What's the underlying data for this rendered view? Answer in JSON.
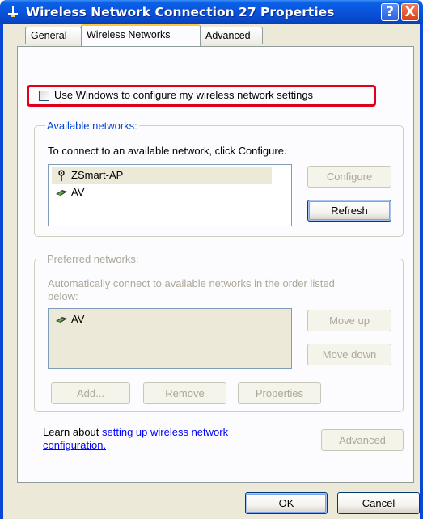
{
  "window": {
    "title": "Wireless Network Connection 27 Properties",
    "help_label": "?",
    "close_label": "X"
  },
  "tabs": [
    {
      "label": "General",
      "active": false
    },
    {
      "label": "Wireless Networks",
      "active": true
    },
    {
      "label": "Advanced",
      "active": false
    }
  ],
  "use_windows": {
    "label": "Use Windows to configure my wireless network settings",
    "checked": false
  },
  "available": {
    "title": "Available networks:",
    "instruction": "To connect to an available network, click Configure.",
    "networks": [
      {
        "name": "ZSmart-AP",
        "icon": "antenna-icon",
        "selected": true
      },
      {
        "name": "AV",
        "icon": "adhoc-network-icon",
        "selected": false
      }
    ],
    "configure_label": "Configure",
    "refresh_label": "Refresh"
  },
  "preferred": {
    "title": "Preferred networks:",
    "instruction_line1": "Automatically connect to available networks in the order listed",
    "instruction_line2": "below:",
    "networks": [
      {
        "name": "AV",
        "icon": "adhoc-network-icon"
      }
    ],
    "move_up_label": "Move up",
    "move_down_label": "Move down",
    "add_label": "Add...",
    "remove_label": "Remove",
    "properties_label": "Properties"
  },
  "learn": {
    "prefix": "Learn about ",
    "link_line1": "setting up wireless network",
    "link_line2": "configuration.",
    "advanced_label": "Advanced"
  },
  "footer": {
    "ok_label": "OK",
    "cancel_label": "Cancel"
  },
  "colors": {
    "titlebar": "#0a53da",
    "highlight": "#e0001b",
    "link": "#0000ff",
    "disabled_text": "#aca899"
  }
}
